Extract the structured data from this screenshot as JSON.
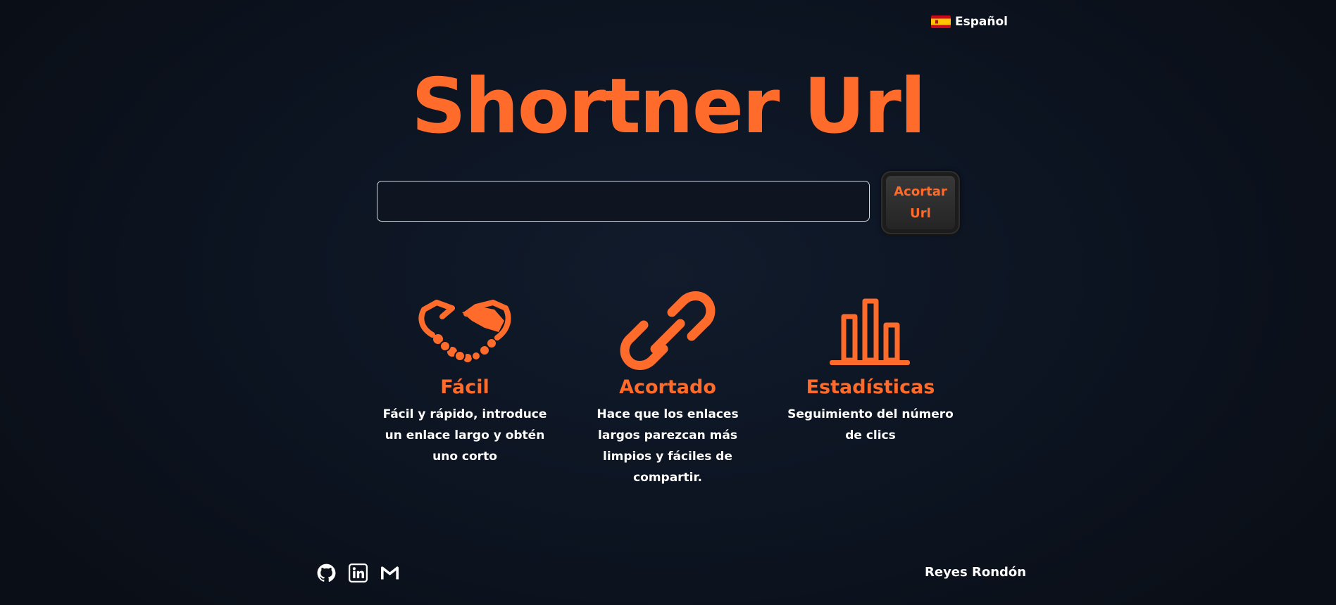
{
  "language": {
    "label": "Español",
    "flag_icon": "spain-flag-icon"
  },
  "title": "Shortner Url",
  "form": {
    "input_value": "",
    "input_placeholder": "",
    "button_label_line1": "Acortar",
    "button_label_line2": "Url"
  },
  "features": [
    {
      "icon": "handshake-icon",
      "title": "Fácil",
      "lines": [
        "Fácil y rápido, introduce",
        "un enlace largo y obtén",
        "uno corto"
      ]
    },
    {
      "icon": "link-icon",
      "title": "Acortado",
      "lines": [
        "Hace que los enlaces",
        "largos parezcan más",
        "limpios y fáciles de",
        "compartir."
      ]
    },
    {
      "icon": "bar-chart-icon",
      "title": "Estadísticas",
      "lines": [
        "Seguimiento del número",
        "de clics"
      ]
    }
  ],
  "footer": {
    "social_icons": [
      "github-icon",
      "linkedin-icon",
      "gmail-icon"
    ],
    "author": "Reyes Rondón"
  },
  "colors": {
    "accent": "#ff6b2b",
    "background": "#0d1523",
    "text": "#ffffff"
  }
}
